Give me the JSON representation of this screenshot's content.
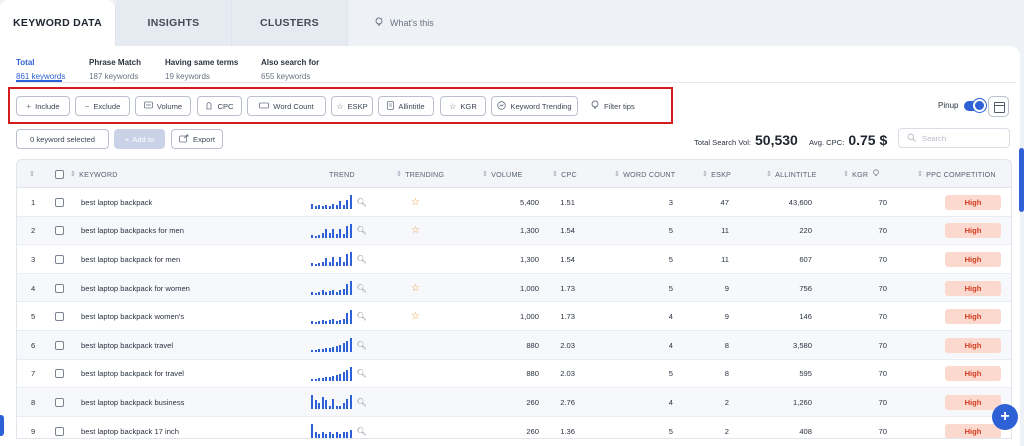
{
  "tabs": [
    {
      "label": "KEYWORD DATA",
      "active": true
    },
    {
      "label": "INSIGHTS",
      "active": false
    },
    {
      "label": "CLUSTERS",
      "active": false
    }
  ],
  "whats_this": "What's this",
  "subtabs": [
    {
      "title": "Total",
      "count": "861 keywords",
      "active": true
    },
    {
      "title": "Phrase Match",
      "count": "187 keywords",
      "active": false
    },
    {
      "title": "Having same terms",
      "count": "19 keywords",
      "active": false
    },
    {
      "title": "Also search for",
      "count": "655 keywords",
      "active": false
    }
  ],
  "filters": [
    {
      "label": "Include",
      "icon": "plus-icon"
    },
    {
      "label": "Exclude",
      "icon": "minus-icon"
    },
    {
      "label": "Volume",
      "icon": "volume-icon"
    },
    {
      "label": "CPC",
      "icon": "cpc-icon"
    },
    {
      "label": "Word Count",
      "icon": "word-count-icon"
    },
    {
      "label": "ESKP",
      "icon": "star-icon"
    },
    {
      "label": "Allintitle",
      "icon": "document-icon"
    },
    {
      "label": "KGR",
      "icon": "star-icon"
    },
    {
      "label": "Keyword Trending",
      "icon": "trending-icon"
    }
  ],
  "filter_tips": "Filter tips",
  "pinup_label": "Pinup",
  "selected_label": "0 keyword selected",
  "add_to_label": "Add to",
  "export_label": "Export",
  "total_search_vol_label": "Total Search Vol:",
  "total_search_vol": "50,530",
  "avg_cpc_label": "Avg. CPC:",
  "avg_cpc": "0.75 $",
  "search_placeholder": "Search",
  "columns": [
    "KEYWORD",
    "TREND",
    "TRENDING",
    "VOLUME",
    "CPC",
    "WORD COUNT",
    "ESKP",
    "ALLINTITLE",
    "KGR",
    "PPC COMPETITION"
  ],
  "rows": [
    {
      "n": "1",
      "keyword": "best laptop backpack",
      "trend": [
        5,
        3,
        4,
        3,
        4,
        3,
        5,
        4,
        8,
        4,
        9,
        14
      ],
      "trending": true,
      "volume": "5,400",
      "cpc": "1.51",
      "words": "3",
      "eskp": "47",
      "allintitle": "43,600",
      "kgr": "70",
      "ppc": "High"
    },
    {
      "n": "2",
      "keyword": "best laptop backpacks for men",
      "trend": [
        3,
        2,
        3,
        5,
        9,
        5,
        9,
        4,
        9,
        4,
        12,
        14
      ],
      "trending": true,
      "volume": "1,300",
      "cpc": "1.54",
      "words": "5",
      "eskp": "11",
      "allintitle": "220",
      "kgr": "70",
      "ppc": "High"
    },
    {
      "n": "3",
      "keyword": "best laptop backpack for men",
      "trend": [
        3,
        2,
        3,
        4,
        8,
        4,
        9,
        4,
        9,
        4,
        12,
        14
      ],
      "trending": false,
      "volume": "1,300",
      "cpc": "1.54",
      "words": "5",
      "eskp": "11",
      "allintitle": "607",
      "kgr": "70",
      "ppc": "High"
    },
    {
      "n": "4",
      "keyword": "best laptop backpack for women",
      "trend": [
        3,
        2,
        3,
        5,
        3,
        4,
        5,
        3,
        5,
        6,
        11,
        14
      ],
      "trending": true,
      "volume": "1,000",
      "cpc": "1.73",
      "words": "5",
      "eskp": "9",
      "allintitle": "756",
      "kgr": "70",
      "ppc": "High"
    },
    {
      "n": "5",
      "keyword": "best laptop backpack women's",
      "trend": [
        3,
        2,
        3,
        4,
        3,
        4,
        5,
        3,
        4,
        5,
        11,
        14
      ],
      "trending": true,
      "volume": "1,000",
      "cpc": "1.73",
      "words": "4",
      "eskp": "9",
      "allintitle": "146",
      "kgr": "70",
      "ppc": "High"
    },
    {
      "n": "6",
      "keyword": "best laptop backpack travel",
      "trend": [
        2,
        2,
        3,
        3,
        4,
        4,
        5,
        6,
        7,
        9,
        11,
        14
      ],
      "trending": false,
      "volume": "880",
      "cpc": "2.03",
      "words": "4",
      "eskp": "8",
      "allintitle": "3,580",
      "kgr": "70",
      "ppc": "High"
    },
    {
      "n": "7",
      "keyword": "best laptop backpack for travel",
      "trend": [
        2,
        2,
        3,
        3,
        4,
        4,
        5,
        6,
        7,
        9,
        11,
        14
      ],
      "trending": false,
      "volume": "880",
      "cpc": "2.03",
      "words": "5",
      "eskp": "8",
      "allintitle": "595",
      "kgr": "70",
      "ppc": "High"
    },
    {
      "n": "8",
      "keyword": "best laptop backpack business",
      "trend": [
        14,
        9,
        6,
        12,
        9,
        3,
        10,
        3,
        3,
        6,
        10,
        14
      ],
      "trending": false,
      "volume": "260",
      "cpc": "2.76",
      "words": "4",
      "eskp": "2",
      "allintitle": "1,260",
      "kgr": "70",
      "ppc": "High"
    },
    {
      "n": "9",
      "keyword": "best laptop backpack 17 inch",
      "trend": [
        14,
        6,
        4,
        6,
        4,
        6,
        4,
        6,
        4,
        6,
        6,
        8
      ],
      "trending": false,
      "volume": "260",
      "cpc": "1.36",
      "words": "5",
      "eskp": "2",
      "allintitle": "408",
      "kgr": "70",
      "ppc": "High"
    }
  ]
}
